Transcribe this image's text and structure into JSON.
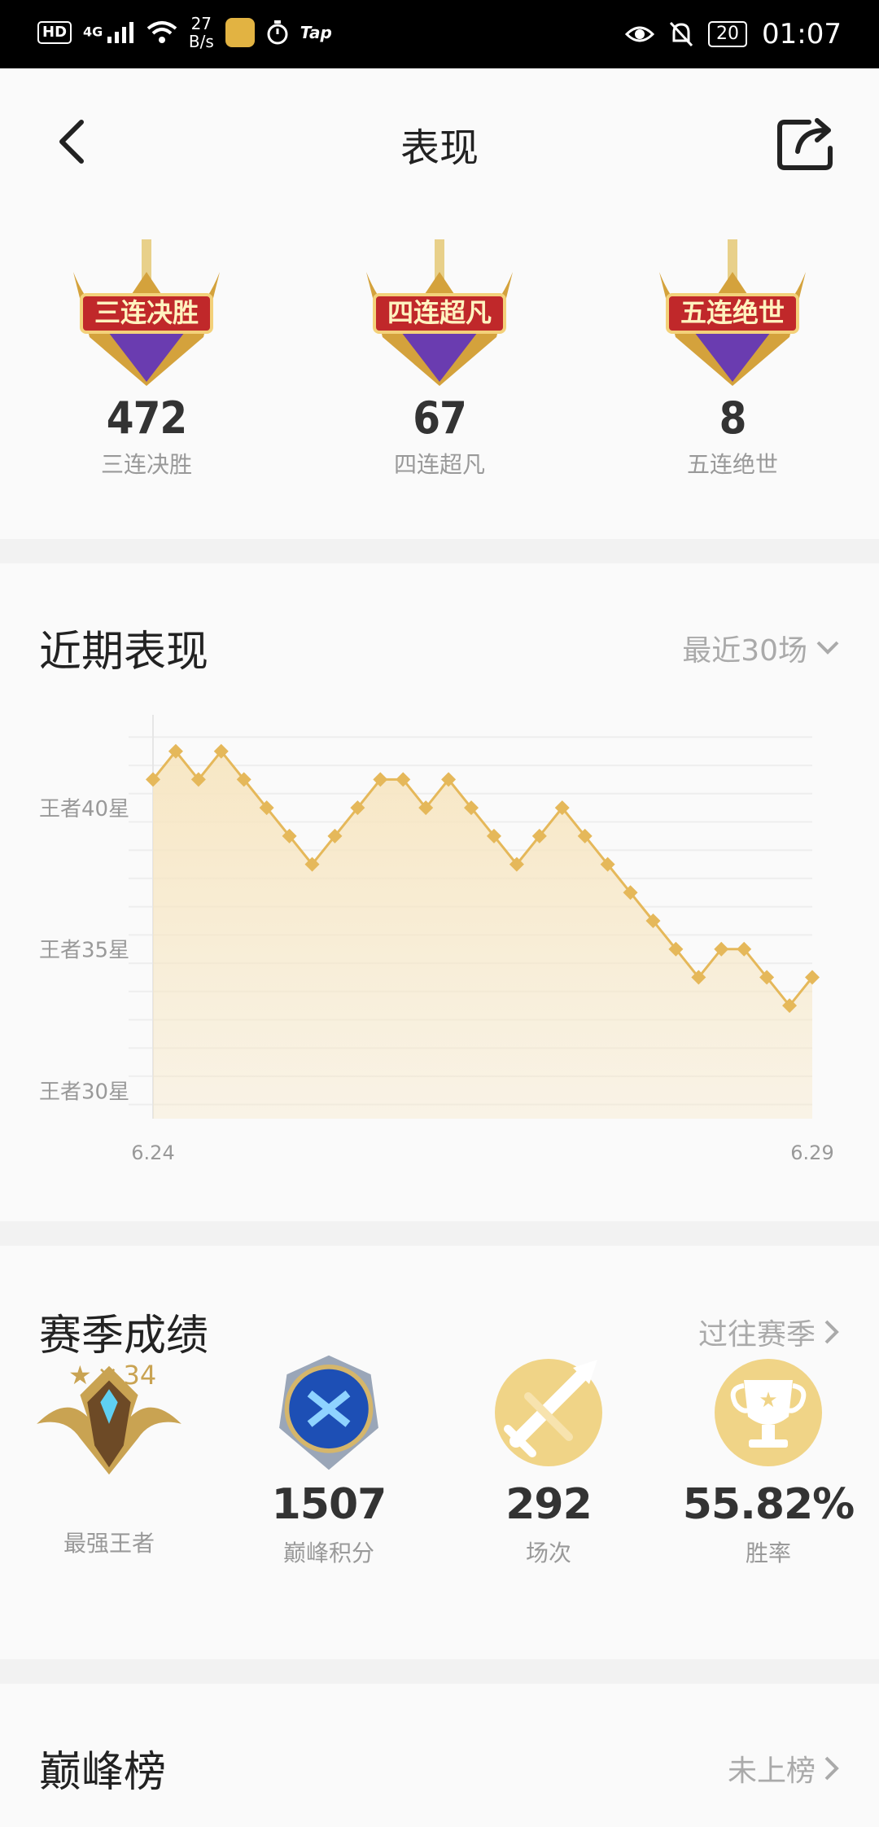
{
  "status_bar": {
    "hd": "HD",
    "signal": "4G",
    "speed_value": "27",
    "speed_unit": "B/s",
    "tap": "Tap",
    "battery": "20",
    "time": "01:07"
  },
  "nav": {
    "title": "表现",
    "back_icon": "chevron-left-icon",
    "share_icon": "share-icon"
  },
  "achievements": [
    {
      "badge_text": "三连决胜",
      "value": "472",
      "label": "三连决胜"
    },
    {
      "badge_text": "四连超凡",
      "value": "67",
      "label": "四连超凡"
    },
    {
      "badge_text": "五连绝世",
      "value": "8",
      "label": "五连绝世"
    }
  ],
  "recent": {
    "title": "近期表现",
    "filter_label": "最近30场"
  },
  "chart_data": {
    "type": "area",
    "y_tick_labels": [
      "王者40星",
      "王者35星",
      "王者30星"
    ],
    "y_tick_values": [
      40,
      35,
      30
    ],
    "x_tick_labels": [
      "6.24",
      "6.29"
    ],
    "ylim": [
      29,
      43
    ],
    "values": [
      41,
      42,
      41,
      42,
      41,
      40,
      39,
      38,
      39,
      40,
      41,
      41,
      40,
      41,
      40,
      39,
      38,
      39,
      40,
      39,
      38,
      37,
      36,
      35,
      34,
      35,
      35,
      34,
      33,
      34
    ],
    "grid": true,
    "color": "#e5b85a",
    "fill_color": "#f7e6c2"
  },
  "season": {
    "title": "赛季成绩",
    "link_label": "过往赛季",
    "rank_stars": "34",
    "stats": [
      {
        "value": "",
        "label": "最强王者",
        "icon": "king-rank-emblem-icon"
      },
      {
        "value": "1507",
        "label": "巅峰积分",
        "icon": "peak-emblem-icon"
      },
      {
        "value": "292",
        "label": "场次",
        "icon": "crossed-swords-icon"
      },
      {
        "value": "55.82%",
        "label": "胜率",
        "icon": "trophy-icon"
      }
    ]
  },
  "peak": {
    "title": "巅峰榜",
    "link_label": "未上榜"
  },
  "colors": {
    "gold": "#e5b85a",
    "accent_text": "#c9a352"
  }
}
